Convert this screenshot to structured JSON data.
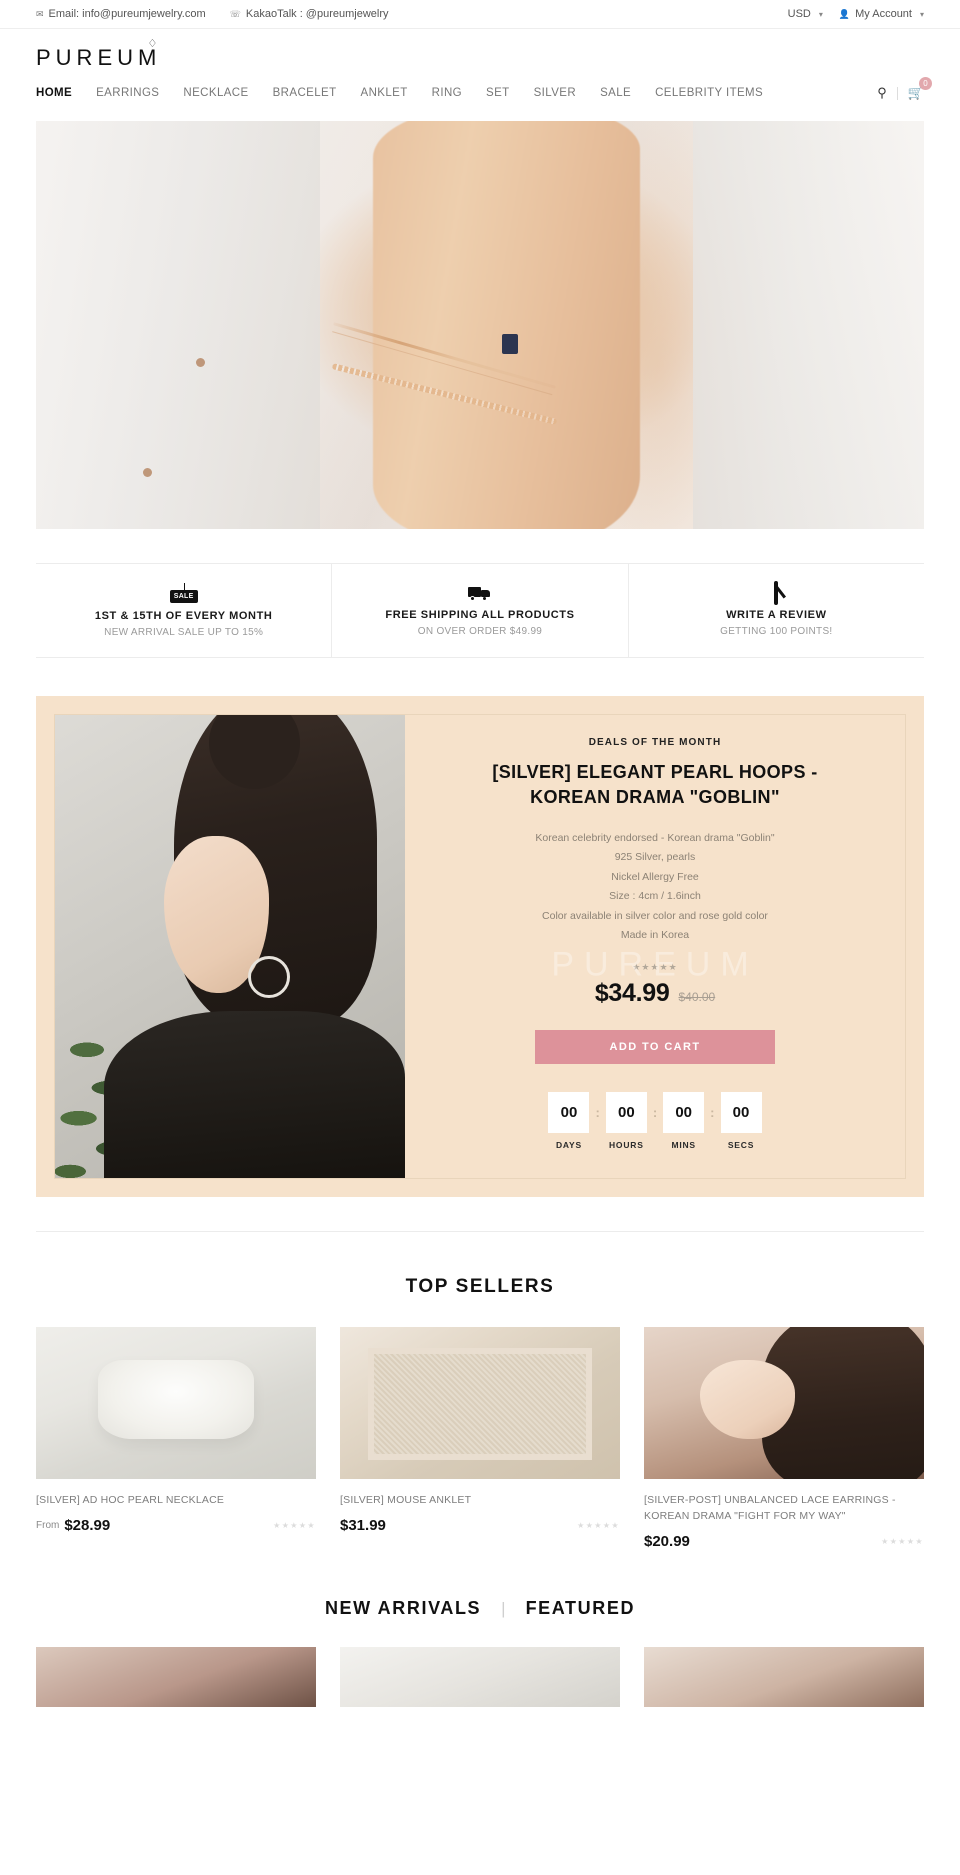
{
  "topbar": {
    "email_icon": "envelope-icon",
    "email": "Email: info@pureumjewelry.com",
    "phone_icon": "phone-icon",
    "kakao": "KakaoTalk : @pureumjewelry",
    "currency": "USD",
    "account_icon": "user-icon",
    "account": "My Account"
  },
  "header": {
    "logo": "PUREUM"
  },
  "nav": {
    "items": [
      {
        "label": "HOME",
        "active": true
      },
      {
        "label": "EARRINGS",
        "active": false
      },
      {
        "label": "NECKLACE",
        "active": false
      },
      {
        "label": "BRACELET",
        "active": false
      },
      {
        "label": "ANKLET",
        "active": false
      },
      {
        "label": "RING",
        "active": false
      },
      {
        "label": "SET",
        "active": false
      },
      {
        "label": "SILVER",
        "active": false
      },
      {
        "label": "SALE",
        "active": false
      },
      {
        "label": "CELEBRITY ITEMS",
        "active": false
      }
    ],
    "search_icon": "search-icon",
    "cart_icon": "shopping-cart-icon",
    "cart_count": "0"
  },
  "features": [
    {
      "icon": "sale-tag-icon",
      "title": "1ST & 15TH OF EVERY MONTH",
      "subtitle": "NEW ARRIVAL SALE UP TO 15%"
    },
    {
      "icon": "delivery-truck-icon",
      "title": "FREE SHIPPING ALL PRODUCTS",
      "subtitle": "ON OVER ORDER $49.99"
    },
    {
      "icon": "pencil-write-icon",
      "title": "WRITE A REVIEW",
      "subtitle": "GETTING 100 POINTS!"
    }
  ],
  "deals": {
    "eyebrow": "DEALS OF THE MONTH",
    "title": "[SILVER] ELEGANT PEARL HOOPS - KOREAN DRAMA \"GOBLIN\"",
    "watermark": "PUREUM",
    "description": [
      "Korean celebrity endorsed - Korean drama \"Goblin\"",
      "925 Silver, pearls",
      "Nickel Allergy Free",
      "Size : 4cm / 1.6inch",
      "Color available in silver color and rose gold color",
      "Made in Korea"
    ],
    "stars": "★★★★★",
    "price": "$34.99",
    "compare_price": "$40.00",
    "add_to_cart": "ADD TO CART",
    "timer": [
      {
        "value": "00",
        "label": "DAYS"
      },
      {
        "value": "00",
        "label": "HOURS"
      },
      {
        "value": "00",
        "label": "MINS"
      },
      {
        "value": "00",
        "label": "SECS"
      }
    ],
    "accent_color": "#dd929a",
    "background_color": "#f6e2cb"
  },
  "top_sellers": {
    "title": "TOP SELLERS",
    "products": [
      {
        "name": "[SILVER] AD HOC PEARL NECKLACE",
        "from": "From",
        "price": "$28.99",
        "stars": "★★★★★"
      },
      {
        "name": "[SILVER] MOUSE ANKLET",
        "from": "",
        "price": "$31.99",
        "stars": "★★★★★"
      },
      {
        "name": "[SILVER-POST] UNBALANCED LACE EARRINGS - KOREAN DRAMA \"FIGHT FOR MY WAY\"",
        "from": "",
        "price": "$20.99",
        "stars": "★★★★★"
      }
    ]
  },
  "bottom_tabs": {
    "new_arrivals": "NEW ARRIVALS",
    "separator": "|",
    "featured": "FEATURED"
  }
}
